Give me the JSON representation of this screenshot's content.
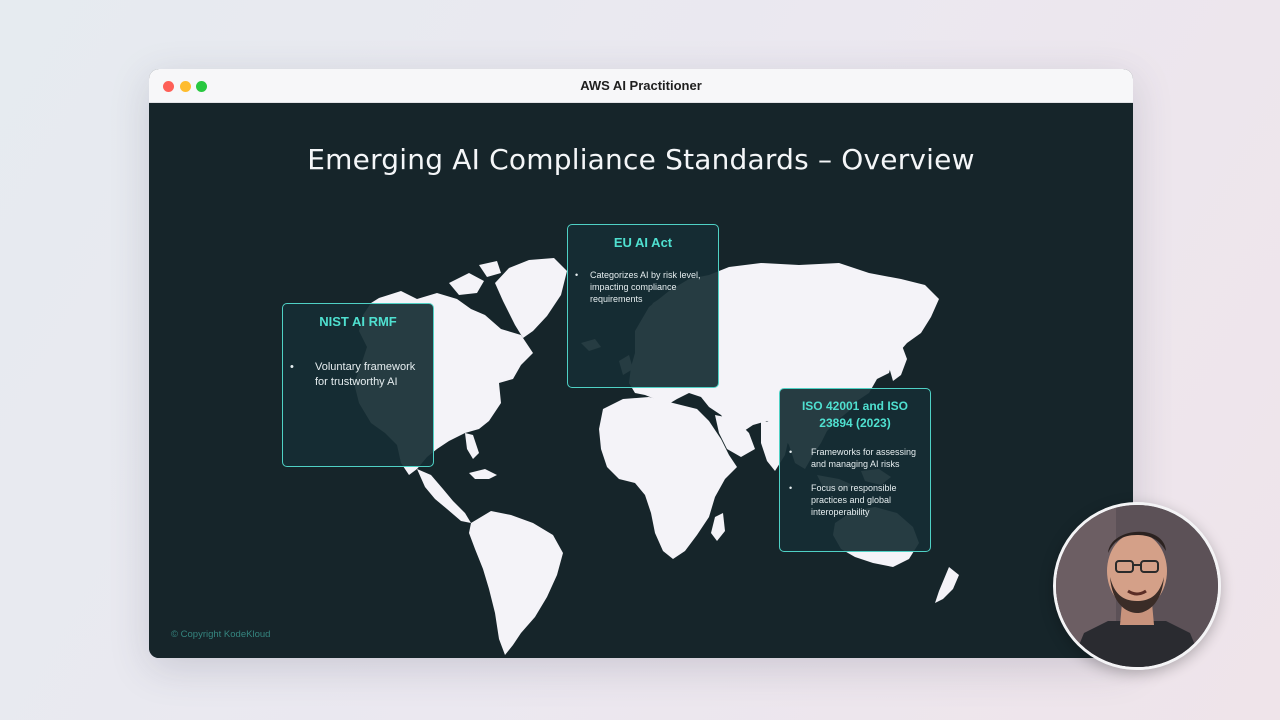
{
  "window": {
    "title": "AWS AI Practitioner"
  },
  "slide": {
    "title": "Emerging AI Compliance Standards – Overview",
    "cards": [
      {
        "title": "NIST AI RMF",
        "bullets": [
          "Voluntary framework for trustworthy AI"
        ]
      },
      {
        "title": "EU AI Act",
        "bullets": [
          "Categorizes AI by risk level, impacting compliance requirements"
        ]
      },
      {
        "title": "ISO 42001 and ISO 23894 (2023)",
        "bullets": [
          "Frameworks for assessing and managing AI risks",
          "Focus on responsible practices and global interoperability"
        ]
      }
    ],
    "copyright": "© Copyright KodeKloud"
  },
  "colors": {
    "slide_bg": "#16252a",
    "accent": "#4fe0d0",
    "map": "#f4f3f8"
  },
  "icons": {
    "map": "world-map",
    "presenter": "presenter-avatar"
  }
}
